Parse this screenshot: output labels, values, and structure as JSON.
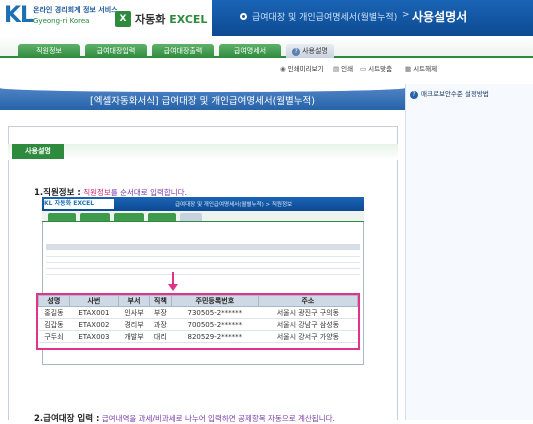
{
  "header": {
    "logo_mark": "KL",
    "logo_line1": "온라인 경리회계 정보 서비스",
    "logo_line2": "Gyeong-ri Korea",
    "brand_icon": "X",
    "brand_name": "자동화",
    "brand_suffix": "EXCEL",
    "breadcrumb": "급여대장 및 개인급여명세서(월별누적)",
    "page_title": "사용설명서"
  },
  "nav_tabs": [
    "직원정보",
    "급여대장입력",
    "급여대장출력",
    "급여명세서",
    "사용설명"
  ],
  "toolbar": {
    "preview": "인쇄미리보기",
    "print": "인쇄",
    "fit": "시트맞춤",
    "sheet_protect": "시트해제"
  },
  "banner": "[엑셀자동화서식] 급여대장 및 개인급여명세서(월별누적)",
  "side_help": "매크로보안수준 설정방법",
  "section_label": "사용설명",
  "step1": {
    "title": "1.직원정보 :",
    "desc_pre": " ",
    "highlight": "직원정보",
    "desc_post": "를 순서대로 입력합니다."
  },
  "step2": {
    "title": "2.급여대장 입력 :",
    "desc": " 급여내역을 과세/비과세로 나누어 입력하면 공제항목 자동으로 계산됩니다."
  },
  "embedded": {
    "crumb": "급여대장 및 개인급여명세서(월별누적) > 직원정보"
  },
  "employee_table": {
    "headers": [
      "성명",
      "사번",
      "부서",
      "직책",
      "주민등록번호",
      "주소"
    ],
    "rows": [
      [
        "홍길동",
        "ETAX001",
        "인사부",
        "부장",
        "730505-2******",
        "서울시 광진구 구의동"
      ],
      [
        "김갑동",
        "ETAX002",
        "경리부",
        "과장",
        "700505-2******",
        "서울시 강남구 삼성동"
      ],
      [
        "구두쇠",
        "ETAX003",
        "개발부",
        "대리",
        "820529-2******",
        "서울시 강서구 가양동"
      ]
    ]
  },
  "colors": {
    "header_blue": "#1a64b6",
    "brand_green": "#2e8b3d",
    "callout_pink": "#e0338a",
    "banner_blue": "#2762a8"
  }
}
